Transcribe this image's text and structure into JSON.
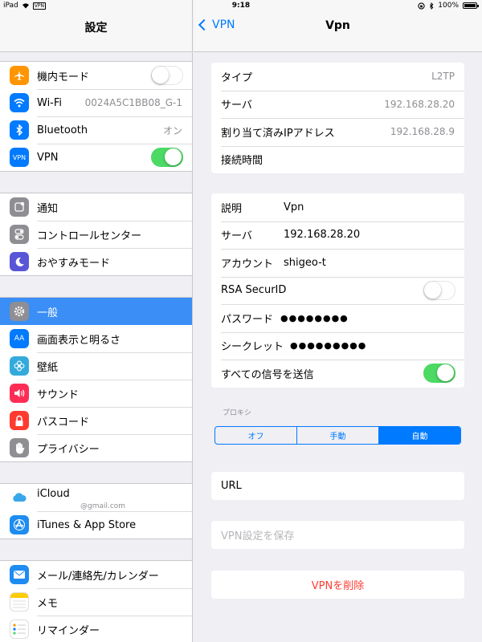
{
  "status_bar": {
    "device": "iPad",
    "vpn_badge": "VPN",
    "time": "9:18",
    "battery": "100%"
  },
  "master": {
    "title": "設定",
    "groups": [
      [
        {
          "label": "機内モード",
          "icon": "airplane-icon",
          "color": "#ff9500",
          "toggle": "off"
        },
        {
          "label": "Wi-Fi",
          "icon": "wifi-icon",
          "color": "#007aff",
          "value": "0024A5C1BB08_G-1"
        },
        {
          "label": "Bluetooth",
          "icon": "bluetooth-icon",
          "color": "#007aff",
          "value": "オン"
        },
        {
          "label": "VPN",
          "icon": "vpn-icon",
          "color": "#007aff",
          "icon_text": "VPN",
          "toggle": "on"
        }
      ],
      [
        {
          "label": "通知",
          "icon": "notifications-icon",
          "color": "#8e8e93"
        },
        {
          "label": "コントロールセンター",
          "icon": "control-center-icon",
          "color": "#8e8e93"
        },
        {
          "label": "おやすみモード",
          "icon": "moon-icon",
          "color": "#5856d6"
        }
      ],
      [
        {
          "label": "一般",
          "icon": "gear-icon",
          "color": "#8e8e93",
          "selected": true
        },
        {
          "label": "画面表示と明るさ",
          "icon": "display-brightness-icon",
          "color": "#007aff",
          "icon_text": "AA"
        },
        {
          "label": "壁紙",
          "icon": "wallpaper-icon",
          "color": "#34aadc"
        },
        {
          "label": "サウンド",
          "icon": "sound-icon",
          "color": "#ff2d55"
        },
        {
          "label": "パスコード",
          "icon": "lock-icon",
          "color": "#ff3b30"
        },
        {
          "label": "プライバシー",
          "icon": "hand-icon",
          "color": "#8e8e93"
        }
      ],
      [
        {
          "label": "iCloud",
          "icon": "icloud-icon",
          "color": "#ffffff",
          "sub": "@gmail.com"
        },
        {
          "label": "iTunes & App Store",
          "icon": "app-store-icon",
          "color": "#1e8cf0"
        }
      ],
      [
        {
          "label": "メール/連絡先/カレンダー",
          "icon": "mail-icon",
          "color": "#1e8cf0"
        },
        {
          "label": "メモ",
          "icon": "notes-icon",
          "color": "#ffffff"
        },
        {
          "label": "リマインダー",
          "icon": "reminders-icon",
          "color": "#ffffff"
        }
      ]
    ]
  },
  "detail": {
    "title": "Vpn",
    "back_label": "VPN",
    "status_section": [
      {
        "label": "タイプ",
        "value": "L2TP"
      },
      {
        "label": "サーバ",
        "value": "192.168.28.20"
      },
      {
        "label": "割り当て済みIPアドレス",
        "value": "192.168.28.9"
      },
      {
        "label": "接続時間",
        "value": ""
      }
    ],
    "config_section": [
      {
        "label": "説明",
        "value": "Vpn"
      },
      {
        "label": "サーバ",
        "value": "192.168.28.20"
      },
      {
        "label": "アカウント",
        "value": "shigeo-t"
      },
      {
        "label": "RSA SecurID",
        "toggle": "off"
      },
      {
        "label": "パスワード",
        "value": "●●●●●●●●"
      },
      {
        "label": "シークレット",
        "value": "●●●●●●●●●"
      },
      {
        "label": "すべての信号を送信",
        "toggle": "on"
      }
    ],
    "proxy": {
      "label": "プロキシ",
      "options": [
        "オフ",
        "手動",
        "自動"
      ],
      "selected": "自動"
    },
    "url_label": "URL",
    "save_label": "VPN設定を保存",
    "delete_label": "VPNを削除"
  },
  "colors": {
    "accent": "#007aff",
    "selection": "#3a8ef6",
    "toggle_on": "#4cd964",
    "destructive": "#ff3b30"
  }
}
